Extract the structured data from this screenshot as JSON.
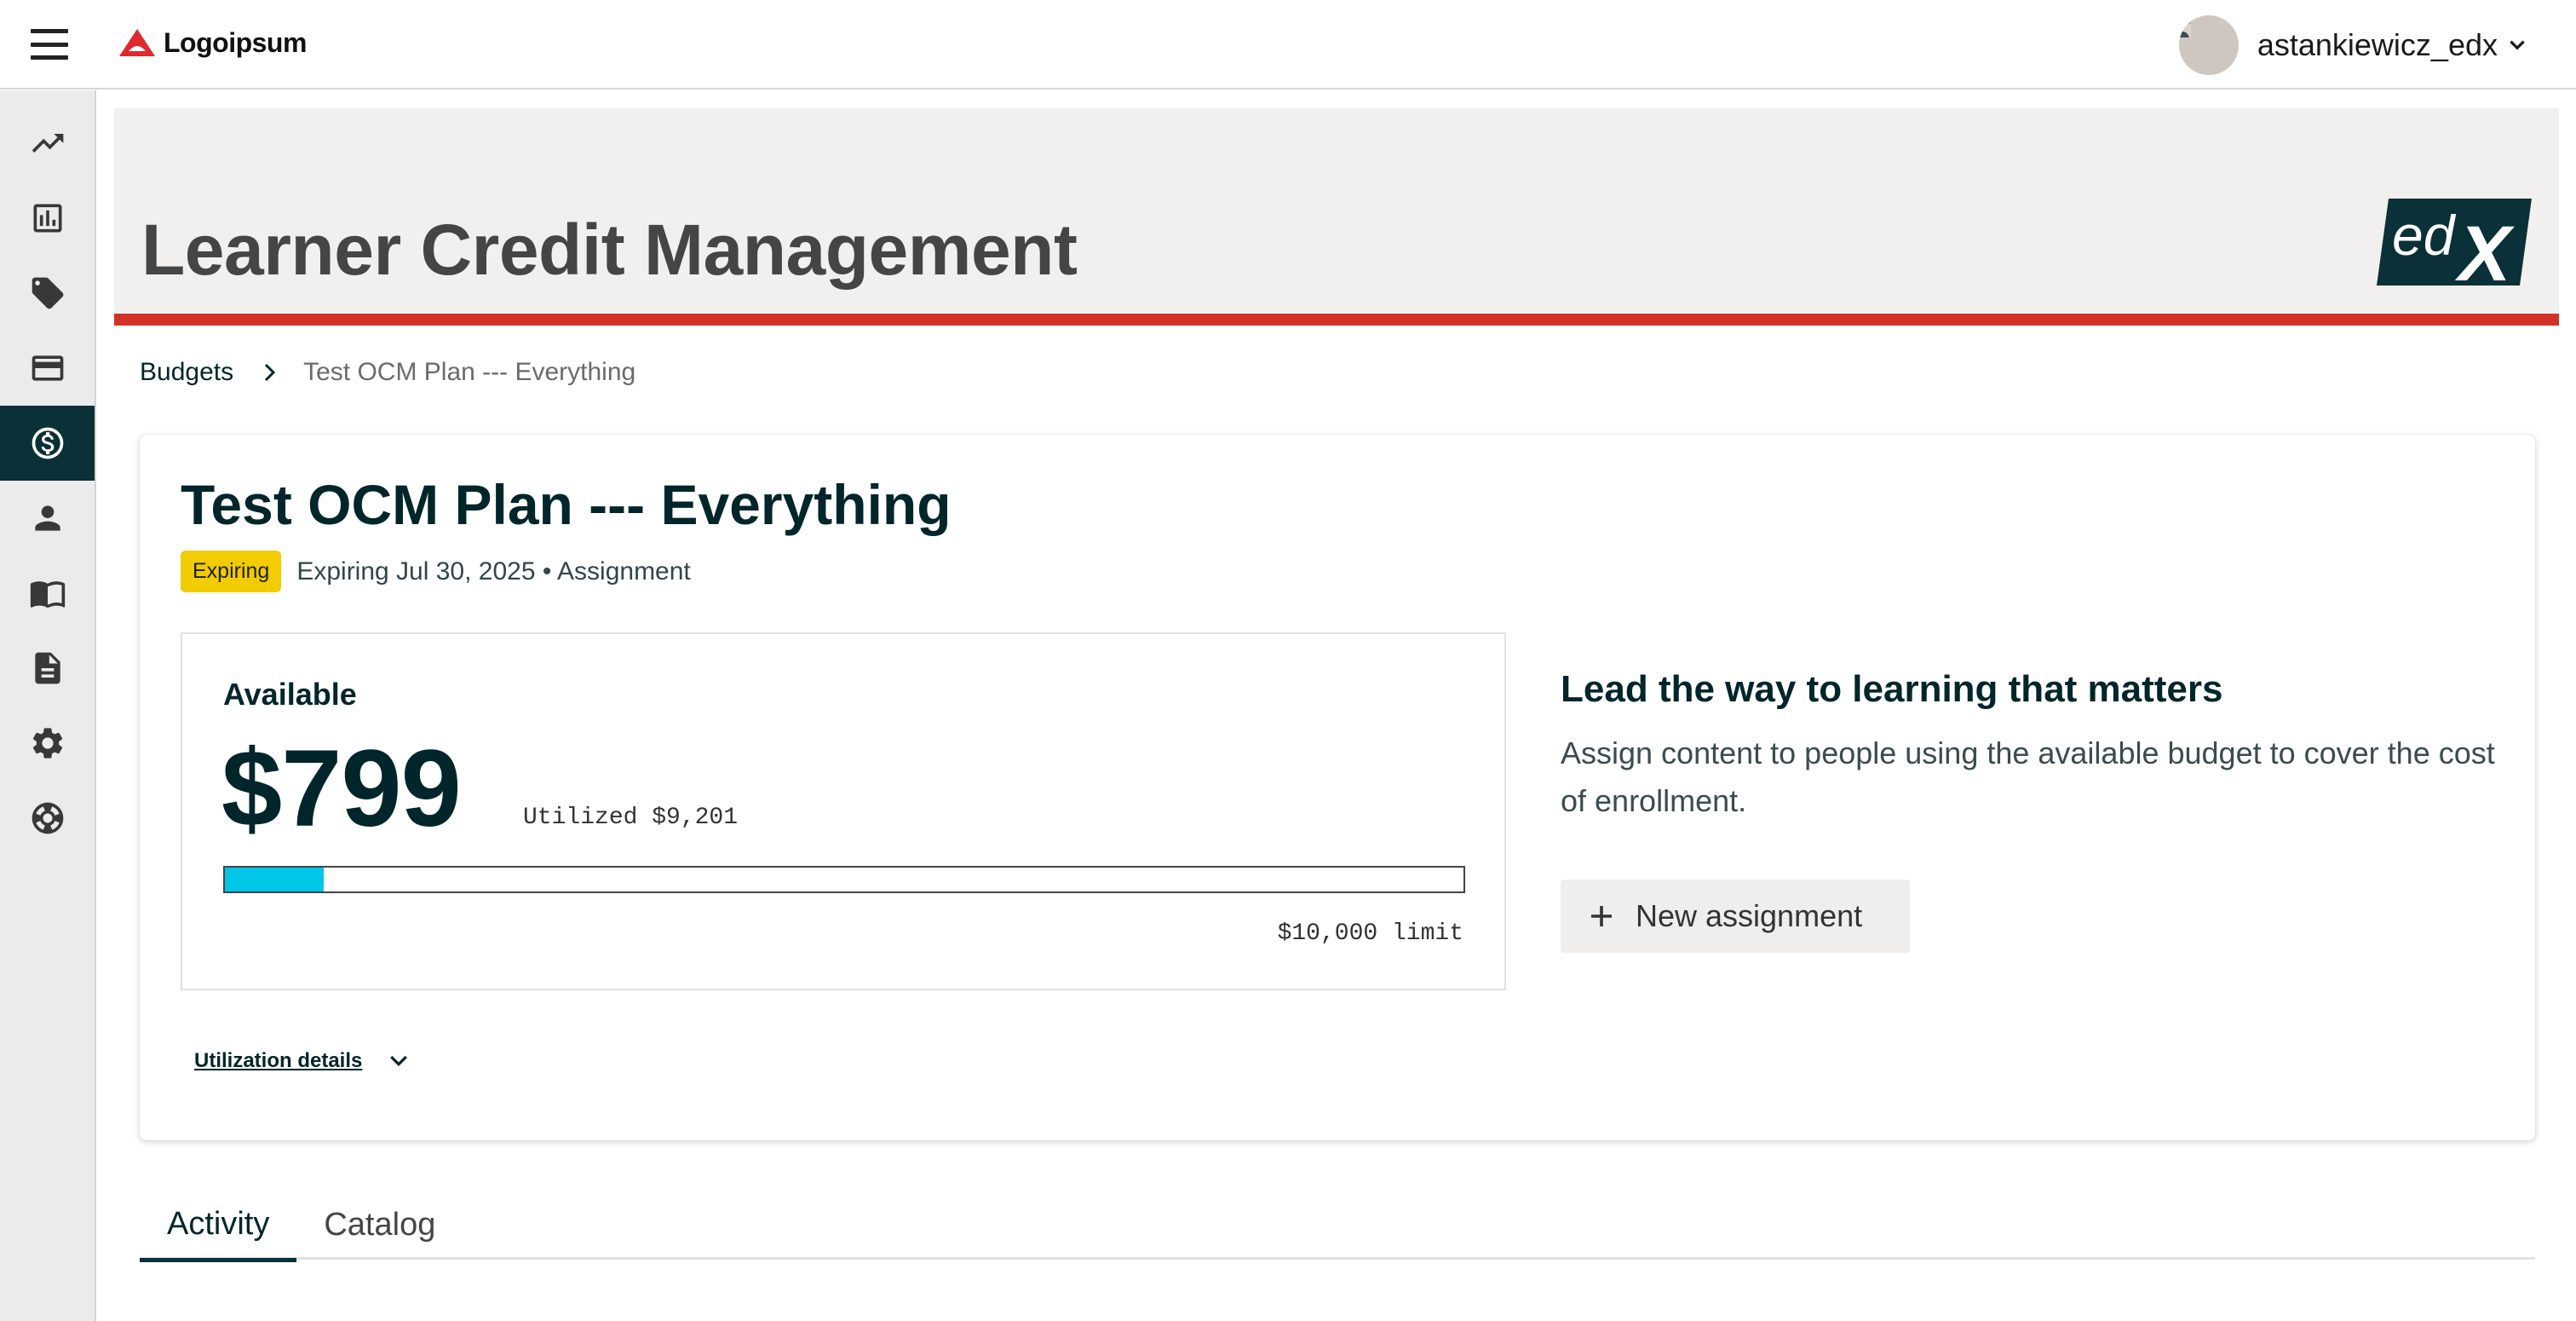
{
  "header": {
    "logo_text": "Logoipsum",
    "username": "astankiewicz_edx"
  },
  "sidebar": {
    "items": [
      {
        "icon": "trending-up-icon"
      },
      {
        "icon": "bar-chart-icon"
      },
      {
        "icon": "tag-icon"
      },
      {
        "icon": "credit-card-icon"
      },
      {
        "icon": "dollar-icon",
        "active": true
      },
      {
        "icon": "person-icon"
      },
      {
        "icon": "book-icon"
      },
      {
        "icon": "document-icon"
      },
      {
        "icon": "gear-icon"
      },
      {
        "icon": "support-icon"
      }
    ]
  },
  "hero": {
    "title": "Learner Credit Management"
  },
  "breadcrumb": {
    "parent": "Budgets",
    "current": "Test OCM Plan --- Everything"
  },
  "budget": {
    "title": "Test OCM Plan --- Everything",
    "status_badge": "Expiring",
    "meta": "Expiring Jul 30, 2025 • Assignment",
    "available_label": "Available",
    "available_amount": "$799",
    "utilized": "Utilized $9,201",
    "limit": "$10,000 limit",
    "utilization_fraction": 0.0799,
    "utilization_details_label": "Utilization details"
  },
  "lead": {
    "title": "Lead the way to learning that matters",
    "description": "Assign content to people using the available budget to cover the cost of enrollment.",
    "button_label": "New assignment"
  },
  "tabs": [
    {
      "label": "Activity",
      "active": true
    },
    {
      "label": "Catalog",
      "active": false
    }
  ],
  "colors": {
    "accent_red": "#d23228",
    "dark_teal": "#0a3038",
    "badge_yellow": "#f0cc00",
    "progress_cyan": "#00c6e8"
  }
}
